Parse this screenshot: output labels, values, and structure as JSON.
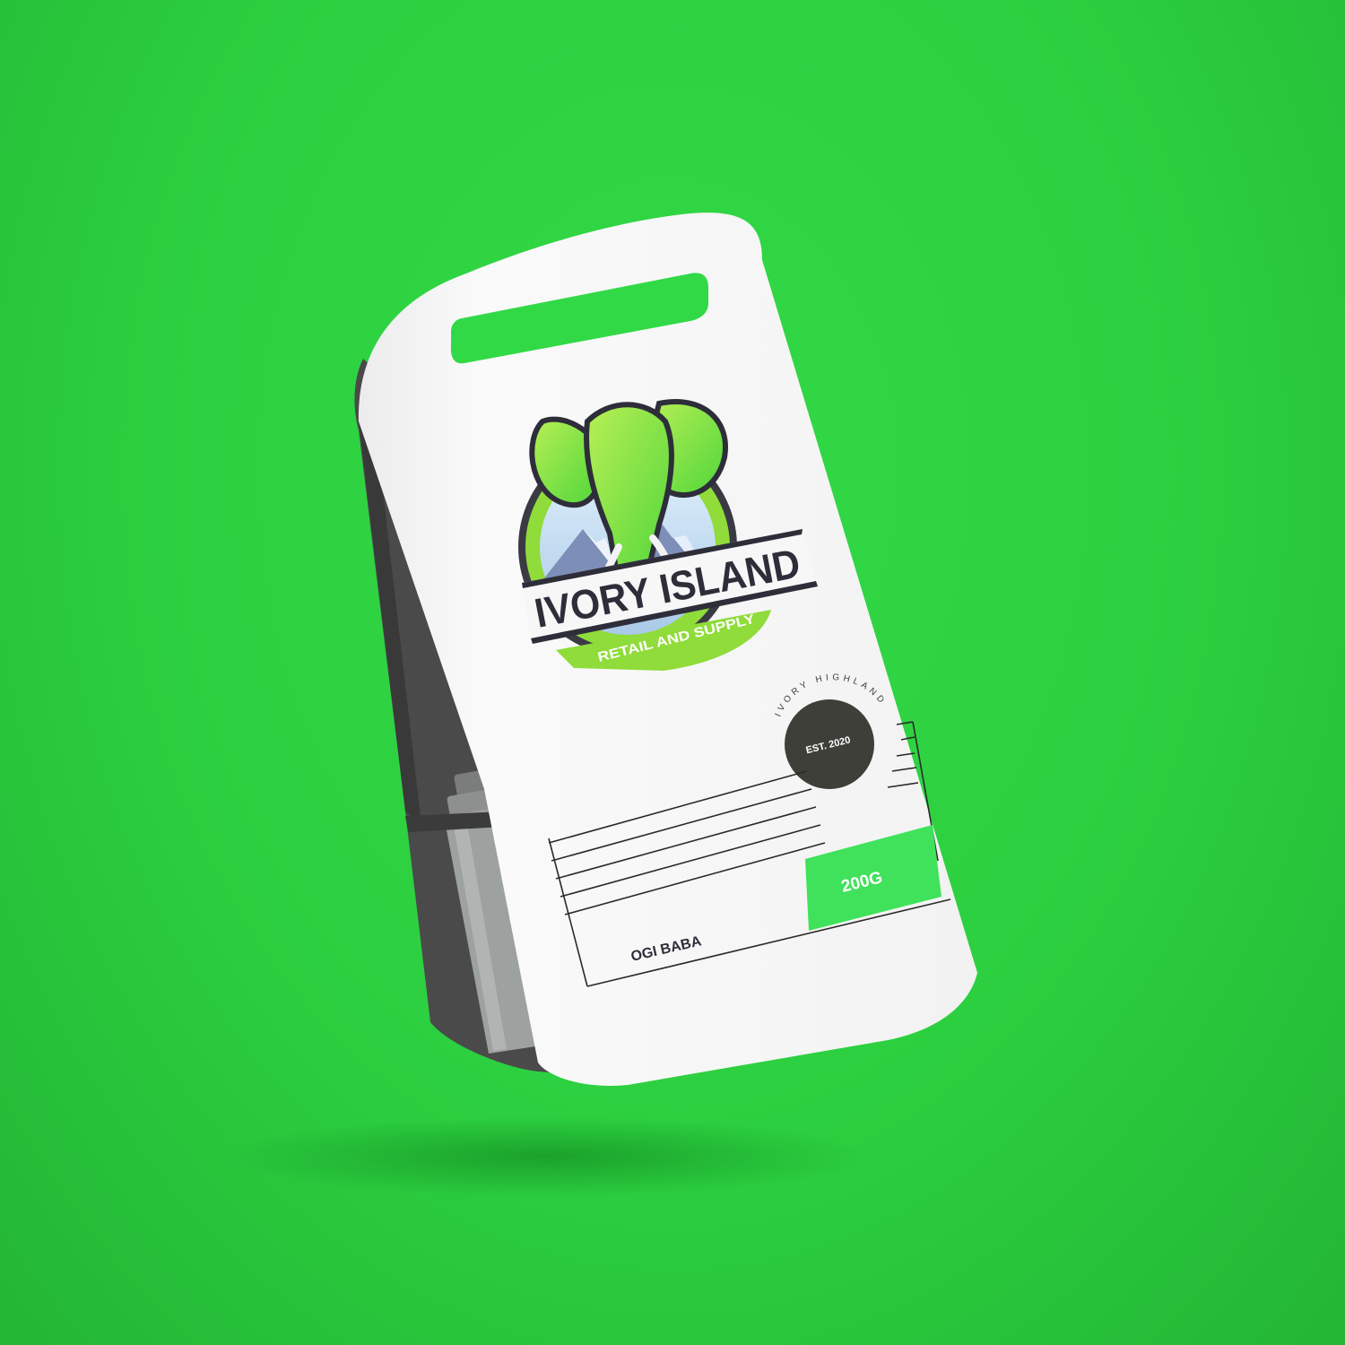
{
  "colors": {
    "background": "#2fd544",
    "accent_green": "#3fe25a",
    "logo_green": "#8fdc3a",
    "dark_gray": "#3f3f3a",
    "package_white": "#f7f7f7",
    "side_panel": "#4a4a4a"
  },
  "logo": {
    "brand_name": "IVORY ISLAND",
    "tagline": "RETAIL AND SUPPLY",
    "icon": "elephant-head-icon"
  },
  "stamp": {
    "center_text": "EST. 2020",
    "ring_text": "IVORY HIGHLAND"
  },
  "product": {
    "weight": "200G",
    "name": "OGI BABA"
  }
}
